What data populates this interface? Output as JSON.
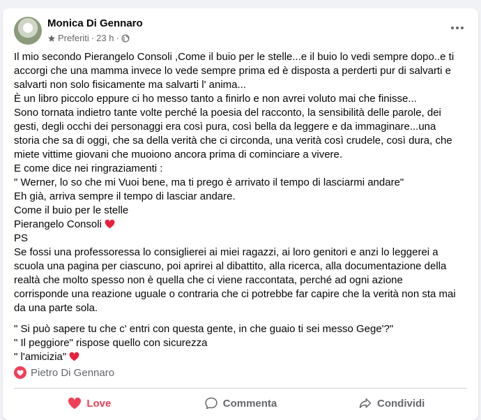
{
  "post": {
    "author": "Monica Di Gennaro",
    "meta_label": "Preferiti",
    "separator": "·",
    "time": "23 h",
    "body": [
      "Il mio secondo Pierangelo Consoli ,Come il buio per le stelle...e il buio lo vedi sempre dopo..e ti",
      "accorgi che una mamma invece lo vede sempre prima ed è disposta a perderti pur di salvarti e",
      "salvarti non solo fisicamente ma salvarti l' anima...",
      "È un libro piccolo eppure ci ho messo tanto a finirlo e non avrei voluto mai che finisse...",
      "Sono tornata indietro tante volte perché la poesia del racconto, la sensibilità delle parole, dei",
      "gesti, degli occhi dei personaggi era così pura, così bella da leggere e da  immaginare...una",
      "storia che sa di oggi, che sa della verità che ci circonda, una verità così crudele, così dura, che",
      "miete vittime giovani che muoiono ancora  prima di cominciare a vivere.",
      "E come dice nei ringraziamenti :",
      "\" Werner, lo so che mi Vuoi bene, ma ti prego è arrivato il tempo di lasciarmi andare\"",
      "Eh già, arriva sempre il tempo di lasciar andare.",
      "Come il buio per le stelle",
      "Pierangelo Consoli",
      "PS",
      "Se fossi una professoressa lo consiglierei ai miei ragazzi, ai loro genitori e anzi lo leggerei a",
      "scuola una pagina per ciascuno, poi aprirei al dibattito, alla ricerca, alla documentazione della",
      "realtà che molto spesso non è quella che ci viene raccontata, perché ad ogni azione",
      "corrisponde una reazione uguale o contraria che ci potrebbe far capire che la verità non sta mai",
      "da una parte sola."
    ],
    "quote": [
      "\" Si può sapere tu che c' entri con questa gente, in che guaio ti sei messo Gege'?\"",
      "\" Il peggiore\" rispose quello con sicurezza",
      "\" l'amicizia\""
    ]
  },
  "reactions": {
    "name": "Pietro Di Gennaro"
  },
  "actions": {
    "love": "Love",
    "comment": "Commenta",
    "share": "Condividi"
  },
  "colors": {
    "love": "#f33e58",
    "secondary_text": "#65676b"
  },
  "icons": [
    "star-icon",
    "globe-icon",
    "more-icon",
    "heart-icon",
    "comment-icon",
    "share-icon"
  ]
}
